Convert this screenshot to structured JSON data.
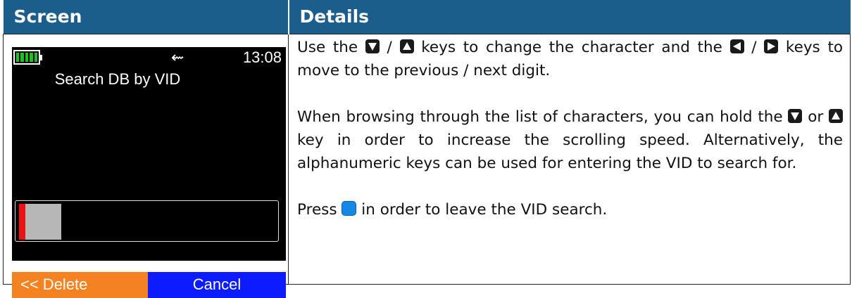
{
  "table": {
    "header_screen": "Screen",
    "header_details": "Details"
  },
  "device": {
    "time": "13:08",
    "usb_glyph": "⇜",
    "title": "Search DB by VID",
    "softkey_left": "<< Delete",
    "softkey_right": "Cancel",
    "colors": {
      "screen_bg": "#000000",
      "battery": "#20c020",
      "cursor": "#ee1111",
      "softkey_left": "#f58220",
      "softkey_right": "#0d1bff"
    }
  },
  "details": {
    "p1_a": "Use the",
    "p1_b": "/",
    "p1_c": "keys to change the character and the",
    "p1_d": "/",
    "p1_e": "keys to move to the previous / next digit.",
    "p2_a": "When browsing through the list of characters, you can hold the",
    "p2_b": "or",
    "p2_c": "key in order to increase the scrolling speed. Alternatively, the alphanumeric keys can be used for entering the VID to search for.",
    "p3_a": "Press",
    "p3_b": "in order to leave the VID search."
  },
  "icons": [
    "down-key-icon",
    "up-key-icon",
    "left-key-icon",
    "right-key-icon",
    "ok-key-icon"
  ],
  "header_color": "#1b5d8c"
}
